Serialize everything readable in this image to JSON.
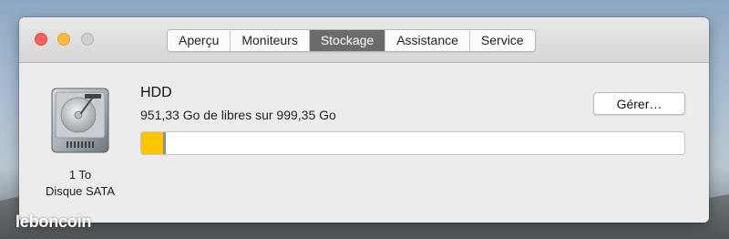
{
  "window": {
    "tabs": [
      "Aperçu",
      "Moniteurs",
      "Stockage",
      "Assistance",
      "Service"
    ],
    "active_tab": "Stockage"
  },
  "disk": {
    "caption_line1": "1 To",
    "caption_line2": "Disque SATA",
    "name": "HDD",
    "summary": "951,33 Go de libres sur 999,35 Go",
    "manage_label": "Gérer…",
    "used_fraction": 0.04,
    "used_color": "#fdc500"
  },
  "watermark": {
    "text": "leboncoin"
  },
  "icons": {
    "close": "close-button-icon",
    "minimize": "minimize-button-icon",
    "zoom": "zoom-button-icon",
    "disk": "hard-drive-icon"
  }
}
